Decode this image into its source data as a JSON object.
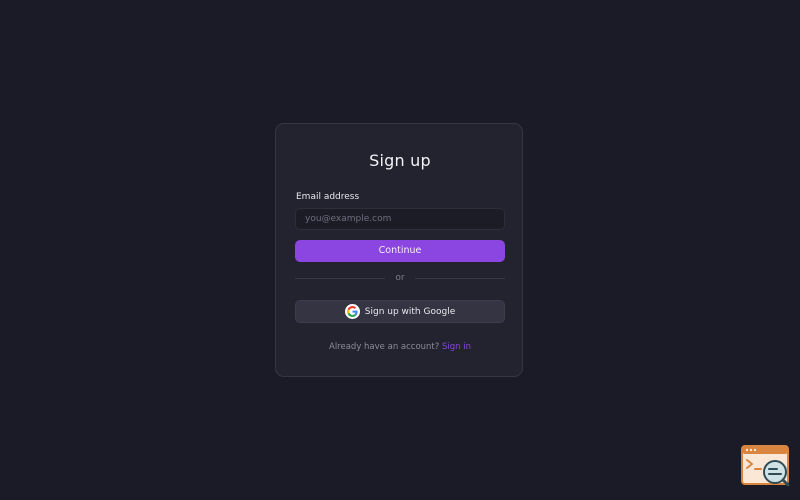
{
  "form": {
    "title": "Sign up",
    "email_label": "Email address",
    "email_placeholder": "you@example.com",
    "email_value": "",
    "continue_label": "Continue",
    "divider_text": "or",
    "google_label": "Sign up with Google",
    "footer_prompt": "Already have an account?",
    "signin_link": "Sign in"
  },
  "icons": {
    "google": "google-icon",
    "corner_widget": "debug-console-icon"
  },
  "colors": {
    "background": "#1b1b27",
    "card": "#23232f",
    "accent": "#8b45e0",
    "google_button": "#343443"
  }
}
